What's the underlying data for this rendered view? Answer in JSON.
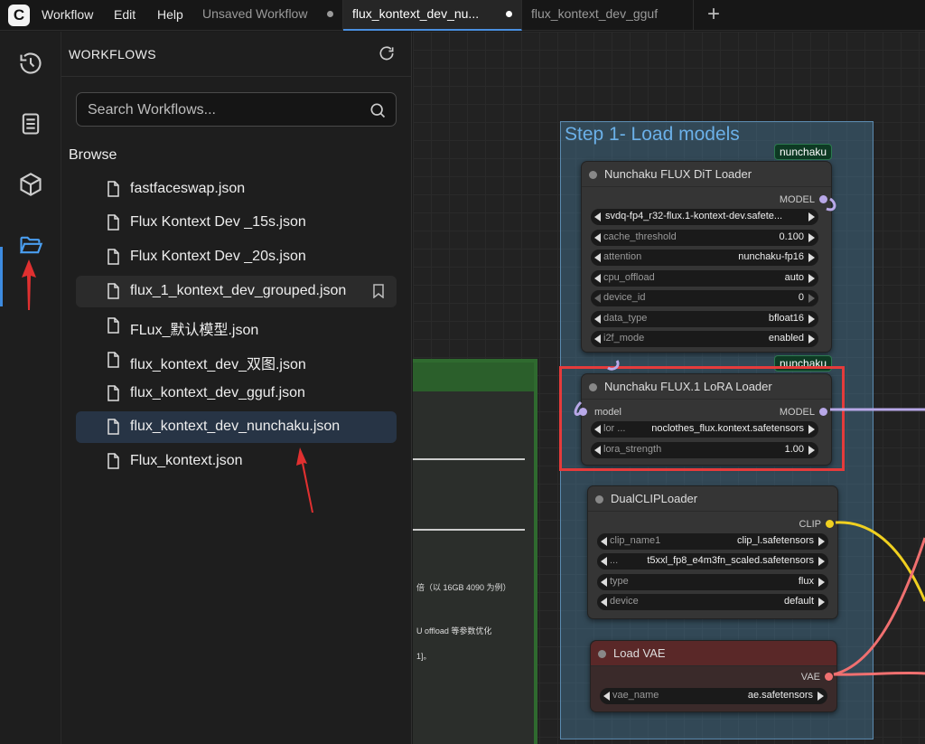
{
  "app": {
    "logo": "C"
  },
  "menu": [
    "Workflow",
    "Edit",
    "Help"
  ],
  "tabs": [
    {
      "label": "Unsaved Workflow",
      "active": false
    },
    {
      "label": "flux_kontext_dev_nu...",
      "active": true
    },
    {
      "label": "flux_kontext_dev_gguf",
      "active": false
    }
  ],
  "rail": {
    "items": [
      "history-icon",
      "book-icon",
      "cube-icon",
      "folder-open-icon"
    ],
    "active": "folder-open-icon"
  },
  "sidebar": {
    "title": "WORKFLOWS",
    "search_placeholder": "Search Workflows...",
    "browse_label": "Browse",
    "files": [
      "fastfaceswap.json",
      "Flux Kontext Dev _15s.json",
      "Flux Kontext Dev _20s.json",
      "flux_1_kontext_dev_grouped.json",
      "FLux_默认模型.json",
      "flux_kontext_dev_双图.json",
      "flux_kontext_dev_gguf.json",
      "flux_kontext_dev_nunchaku.json",
      "Flux_kontext.json"
    ],
    "hovered_file": "flux_1_kontext_dev_grouped.json",
    "selected_file": "flux_kontext_dev_nunchaku.json"
  },
  "canvas": {
    "group_title": "Step 1- Load models",
    "badges": [
      "nunchaku",
      "nunchaku"
    ],
    "background_note_lines": [
      "倍（以 16GB 4090 为例）",
      "U offload 等参数优化",
      "1]。"
    ],
    "nodes": {
      "dit_loader": {
        "title": "Nunchaku FLUX DiT Loader",
        "output": "MODEL",
        "widgets": [
          {
            "label": "",
            "value": "svdq-fp4_r32-flux.1-kontext-dev.safete..."
          },
          {
            "label": "cache_threshold",
            "value": "0.100"
          },
          {
            "label": "attention",
            "value": "nunchaku-fp16"
          },
          {
            "label": "cpu_offload",
            "value": "auto"
          },
          {
            "label": "device_id",
            "value": "0"
          },
          {
            "label": "data_type",
            "value": "bfloat16"
          },
          {
            "label": "i2f_mode",
            "value": "enabled"
          }
        ]
      },
      "lora_loader": {
        "title": "Nunchaku FLUX.1 LoRA Loader",
        "input": "model",
        "output": "MODEL",
        "widgets": [
          {
            "label": "lor ...",
            "value": "noclothes_flux.kontext.safetensors"
          },
          {
            "label": "lora_strength",
            "value": "1.00"
          }
        ]
      },
      "clip_loader": {
        "title": "DualCLIPLoader",
        "output": "CLIP",
        "widgets": [
          {
            "label": "clip_name1",
            "value": "clip_l.safetensors"
          },
          {
            "label": "...",
            "value": "t5xxl_fp8_e4m3fn_scaled.safetensors"
          },
          {
            "label": "type",
            "value": "flux"
          },
          {
            "label": "device",
            "value": "default"
          }
        ]
      },
      "vae_loader": {
        "title": "Load VAE",
        "output": "VAE",
        "widgets": [
          {
            "label": "vae_name",
            "value": "ae.safetensors"
          }
        ]
      }
    }
  },
  "colors": {
    "accent": "#3d8be0",
    "highlight_box": "#e53b3b",
    "annotation_arrow": "#e03030",
    "model_port": "#b8a8e8",
    "clip_port": "#f0d020",
    "vae_port": "#f07070"
  }
}
